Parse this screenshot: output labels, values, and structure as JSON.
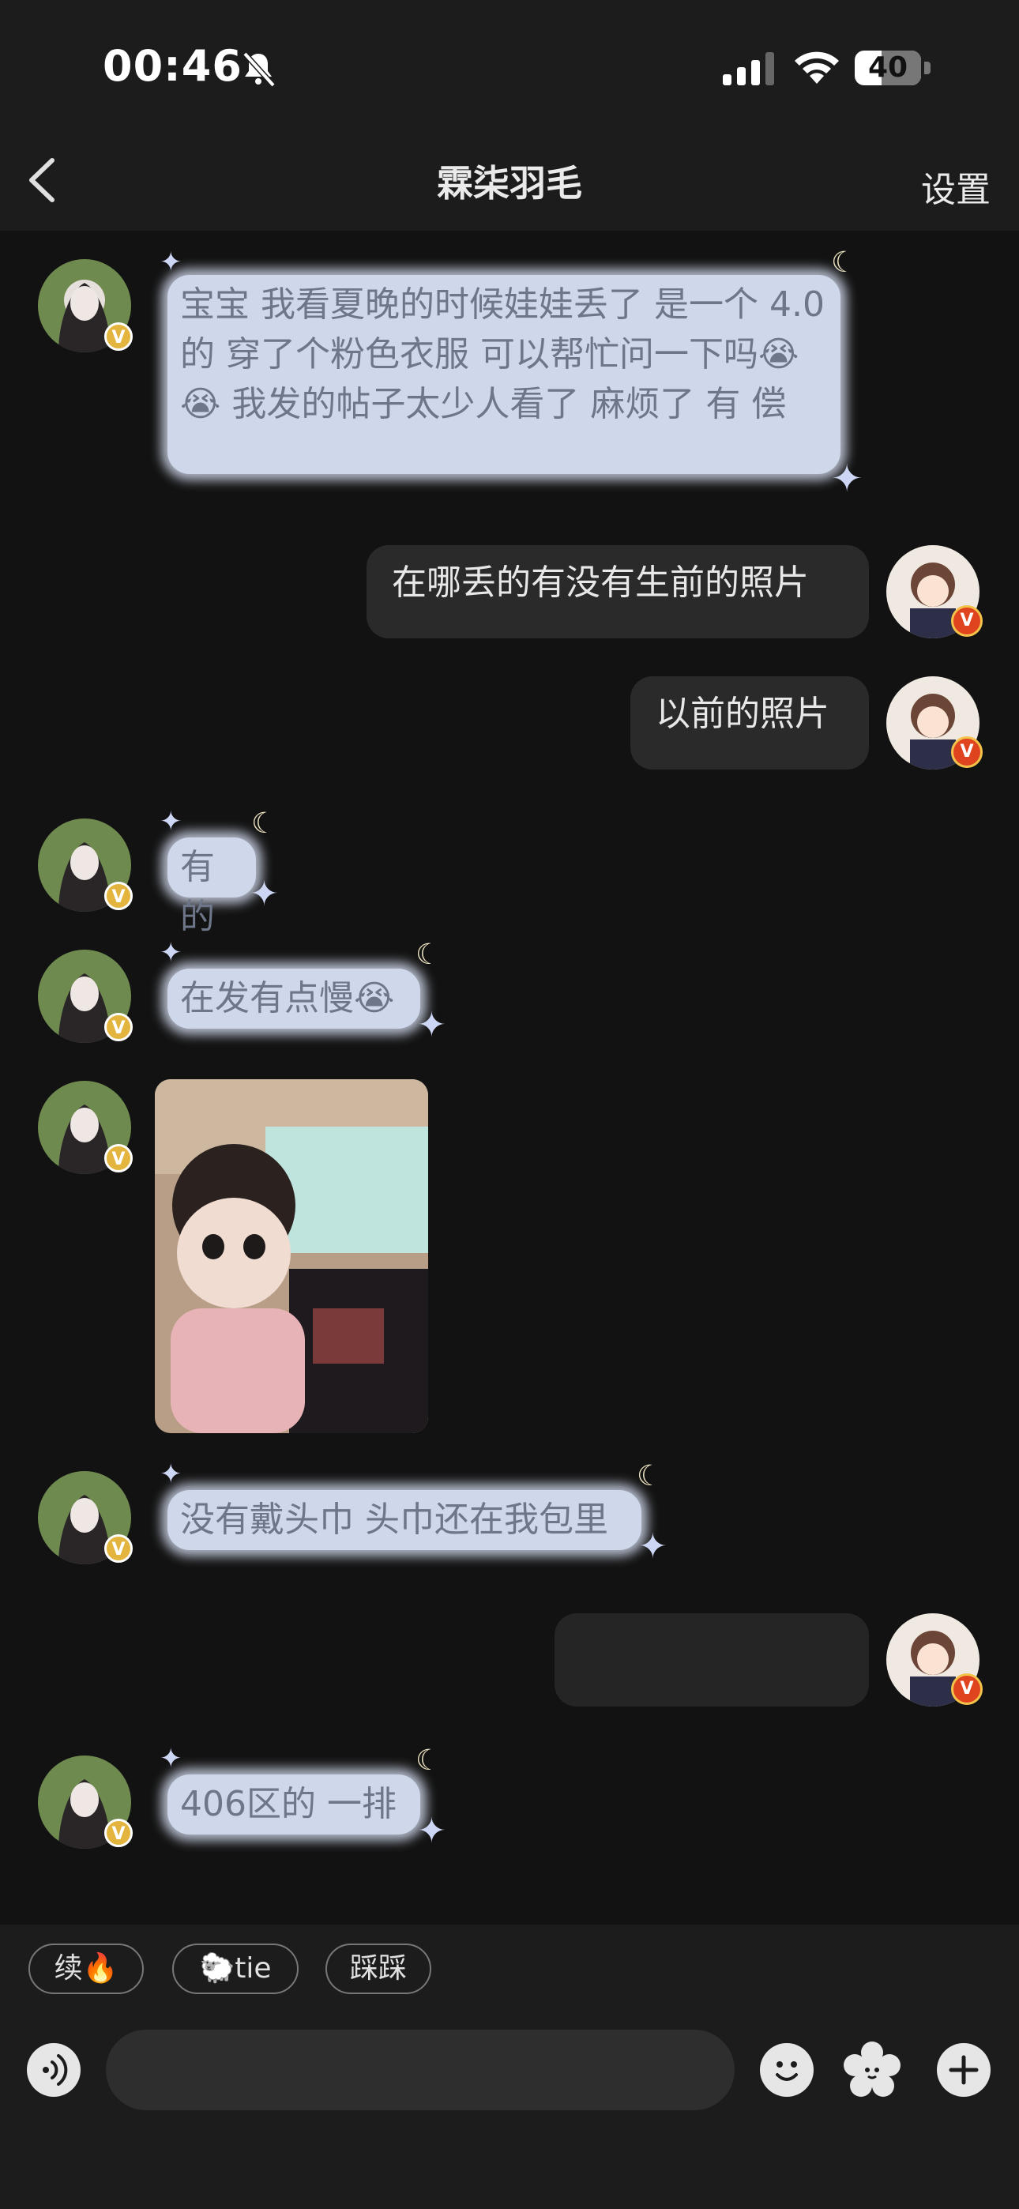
{
  "status_bar": {
    "time": "00:46",
    "battery": "40",
    "battery_level": 0.4
  },
  "nav": {
    "title": "霖柒羽毛",
    "settings": "设置"
  },
  "badges": {
    "verified": "V"
  },
  "messages": [
    {
      "side": "left",
      "text": "宝宝 我看夏晚的时候娃娃丢了 是一个 4.0的 穿了个粉色衣服 可以帮忙问一下吗😭 😭 我发的帖子太少人看了 麻烦了 有 偿"
    },
    {
      "side": "right",
      "text": "在哪丢的有没有生前的照片"
    },
    {
      "side": "right",
      "text": "以前的照片"
    },
    {
      "side": "left",
      "text": "有的"
    },
    {
      "side": "left",
      "text": "在发有点慢😭"
    },
    {
      "side": "left",
      "type": "image"
    },
    {
      "side": "left",
      "text": "没有戴头巾 头巾还在我包里"
    },
    {
      "side": "right",
      "text": ""
    },
    {
      "side": "left",
      "text": "406区的 一排"
    }
  ],
  "quick_replies": [
    "续🔥",
    "🐑tie",
    "踩踩"
  ],
  "input": {
    "placeholder": ""
  },
  "icons": [
    "back-icon",
    "voice-icon",
    "emoji-icon",
    "sticker-icon",
    "plus-icon"
  ]
}
